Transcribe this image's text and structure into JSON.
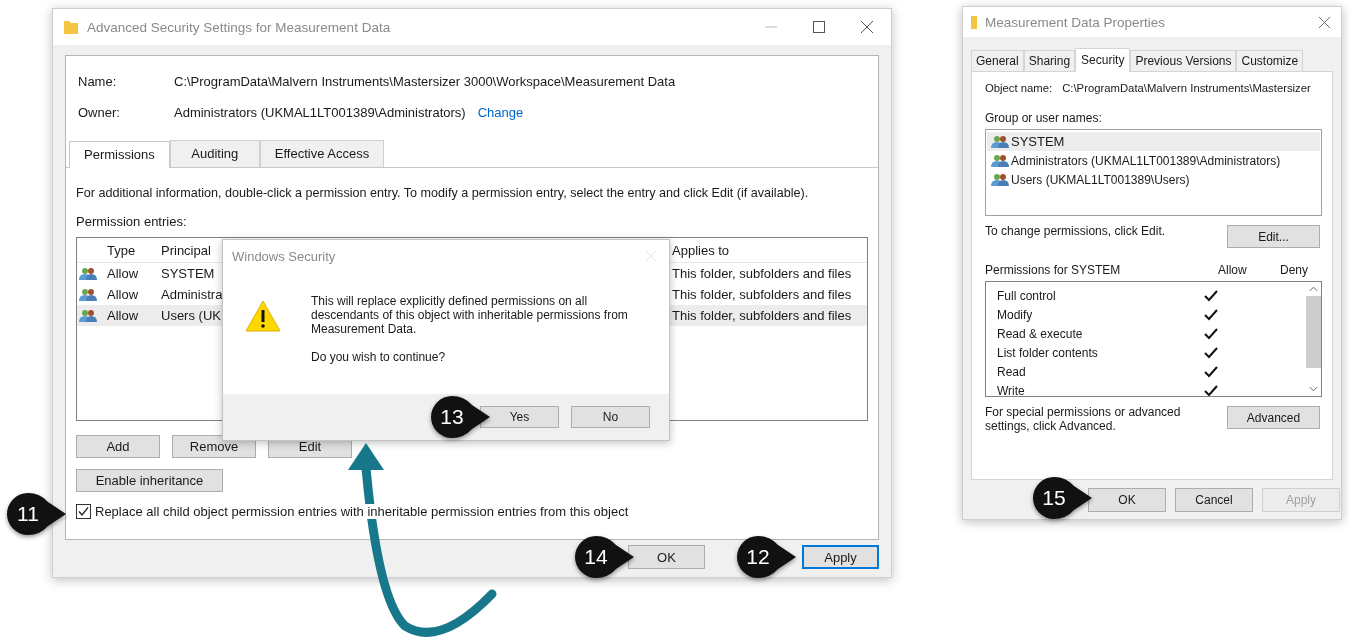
{
  "advanced_window": {
    "title": "Advanced Security Settings for Measurement Data",
    "name_label": "Name:",
    "name_value": "C:\\ProgramData\\Malvern Instruments\\Mastersizer 3000\\Workspace\\Measurement Data",
    "owner_label": "Owner:",
    "owner_value": "Administrators (UKMAL1LT001389\\Administrators)",
    "change_link": "Change",
    "tabs": [
      {
        "label": "Permissions",
        "selected": true
      },
      {
        "label": "Auditing",
        "selected": false
      },
      {
        "label": "Effective Access",
        "selected": false
      }
    ],
    "info_text": "For additional information, double-click a permission entry. To modify a permission entry, select the entry and click Edit (if available).",
    "entries_label": "Permission entries:",
    "columns": [
      "Type",
      "Principal",
      "Applies to"
    ],
    "rows": [
      {
        "type": "Allow",
        "principal": "SYSTEM",
        "applies_to": "This folder, subfolders and files",
        "selected": false
      },
      {
        "type": "Allow",
        "principal": "Administra",
        "applies_to": "This folder, subfolders and files",
        "selected": false
      },
      {
        "type": "Allow",
        "principal": "Users (UK",
        "applies_to": "This folder, subfolders and files",
        "selected": true
      }
    ],
    "list_buttons": [
      "Add",
      "Remove",
      "Edit"
    ],
    "enable_inheritance": "Enable inheritance",
    "replace_checkbox": {
      "label": "Replace all child object permission entries with inheritable permission entries from this object",
      "checked": true
    },
    "footer_buttons": [
      {
        "label": "OK",
        "focused": false
      },
      {
        "label": "Apply",
        "focused": true
      }
    ]
  },
  "dialog": {
    "title": "Windows Security",
    "message": "This will replace explicitly defined permissions on all descendants of this object with inheritable permissions from Measurement Data.",
    "question": "Do you wish to continue?",
    "buttons": [
      "Yes",
      "No"
    ]
  },
  "properties_window": {
    "title": "Measurement Data Properties",
    "tabs": [
      {
        "label": "General",
        "selected": false
      },
      {
        "label": "Sharing",
        "selected": false
      },
      {
        "label": "Security",
        "selected": true
      },
      {
        "label": "Previous Versions",
        "selected": false
      },
      {
        "label": "Customize",
        "selected": false
      }
    ],
    "object_name_label": "Object name:",
    "object_name_value": "C:\\ProgramData\\Malvern Instruments\\Mastersizer",
    "group_label": "Group or user names:",
    "groups": [
      {
        "name": "SYSTEM",
        "selected": true
      },
      {
        "name": "Administrators (UKMAL1LT001389\\Administrators)",
        "selected": false
      },
      {
        "name": "Users (UKMAL1LT001389\\Users)",
        "selected": false
      }
    ],
    "change_text": "To change permissions, click Edit.",
    "edit_button": "Edit...",
    "permissions_label": "Permissions for SYSTEM",
    "allow_header": "Allow",
    "deny_header": "Deny",
    "permissions": [
      {
        "name": "Full control",
        "allow": true,
        "deny": false
      },
      {
        "name": "Modify",
        "allow": true,
        "deny": false
      },
      {
        "name": "Read & execute",
        "allow": true,
        "deny": false
      },
      {
        "name": "List folder contents",
        "allow": true,
        "deny": false
      },
      {
        "name": "Read",
        "allow": true,
        "deny": false
      },
      {
        "name": "Write",
        "allow": true,
        "deny": false
      }
    ],
    "advanced_text": "For special permissions or advanced settings, click Advanced.",
    "advanced_button": "Advanced",
    "buttons": [
      {
        "label": "OK",
        "disabled": false
      },
      {
        "label": "Cancel",
        "disabled": false
      },
      {
        "label": "Apply",
        "disabled": true
      }
    ]
  },
  "callouts": [
    {
      "number": "11"
    },
    {
      "number": "12"
    },
    {
      "number": "13"
    },
    {
      "number": "14"
    },
    {
      "number": "15"
    }
  ]
}
